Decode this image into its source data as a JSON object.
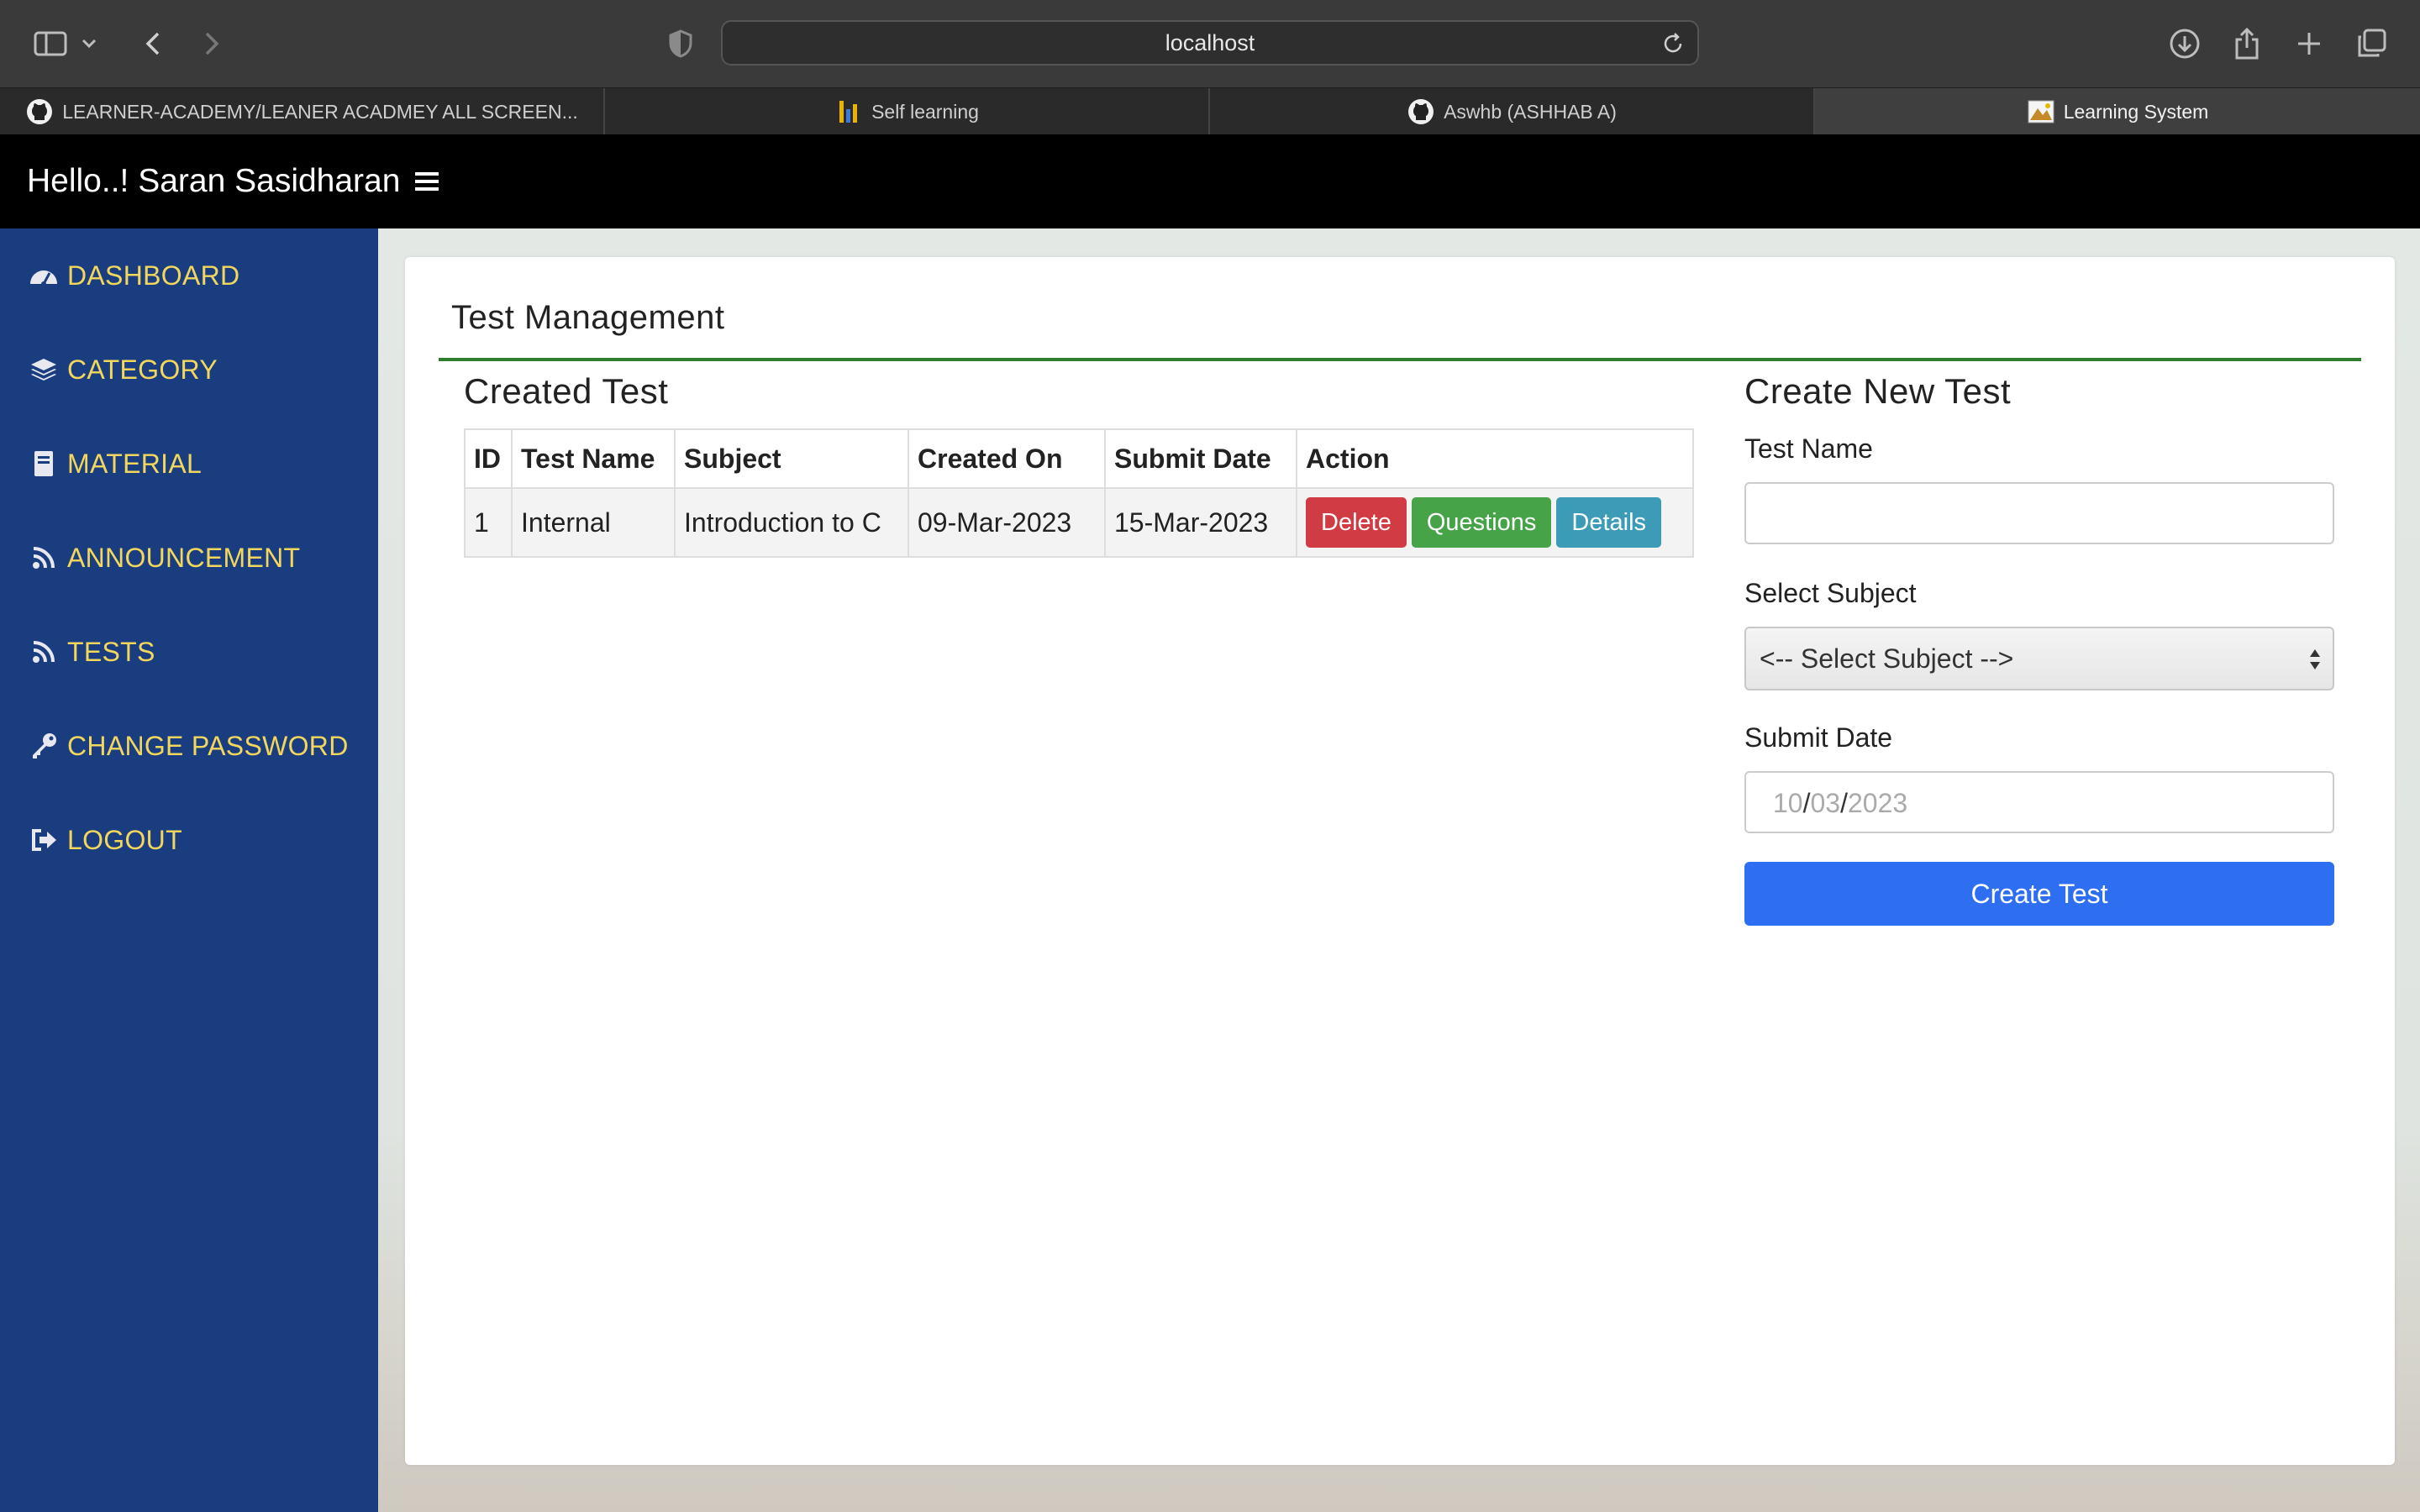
{
  "browser": {
    "url": "localhost",
    "tabs": [
      {
        "title": "LEARNER-ACADEMY/LEANER ACADMEY ALL SCREEN...",
        "favicon": "github-icon",
        "active": false
      },
      {
        "title": "Self learning",
        "favicon": "bars-icon",
        "active": false
      },
      {
        "title": "Aswhb (ASHHAB A)",
        "favicon": "github-icon",
        "active": false
      },
      {
        "title": "Learning System",
        "favicon": "site-icon",
        "active": true
      }
    ]
  },
  "header": {
    "greeting": "Hello..! Saran Sasidharan",
    "menu_icon": "hamburger-icon"
  },
  "sidebar": {
    "items": [
      {
        "label": "DASHBOARD",
        "icon": "dashboard-icon"
      },
      {
        "label": "CATEGORY",
        "icon": "layers-icon"
      },
      {
        "label": "MATERIAL",
        "icon": "book-icon"
      },
      {
        "label": "ANNOUNCEMENT",
        "icon": "rss-icon"
      },
      {
        "label": "TESTS",
        "icon": "rss-icon"
      },
      {
        "label": "CHANGE PASSWORD",
        "icon": "key-icon"
      },
      {
        "label": "LOGOUT",
        "icon": "logout-icon"
      }
    ]
  },
  "main": {
    "title": "Test Management",
    "created": {
      "title": "Created Test",
      "columns": [
        "ID",
        "Test Name",
        "Subject",
        "Created On",
        "Submit Date",
        "Action"
      ],
      "rows": [
        {
          "id": "1",
          "name": "Internal",
          "subject": "Introduction to C",
          "created_on": "09-Mar-2023",
          "submit_date": "15-Mar-2023"
        }
      ],
      "actions": {
        "delete": "Delete",
        "questions": "Questions",
        "details": "Details"
      }
    },
    "form": {
      "title": "Create New Test",
      "test_name_label": "Test Name",
      "test_name_value": "",
      "subject_label": "Select Subject",
      "subject_value": "<-- Select Subject -->",
      "date_label": "Submit Date",
      "date_day": "10",
      "date_month": "03",
      "date_year": "2023",
      "date_sep": "/",
      "submit": "Create Test"
    }
  },
  "colors": {
    "sidebar": "#1a3d80",
    "sidebar_text": "#f2d75c",
    "header": "#000000",
    "rule": "#2f7d2f",
    "primary": "#2d6ff0",
    "danger": "#d13b44",
    "success": "#46a347",
    "info": "#3c9cb8"
  }
}
